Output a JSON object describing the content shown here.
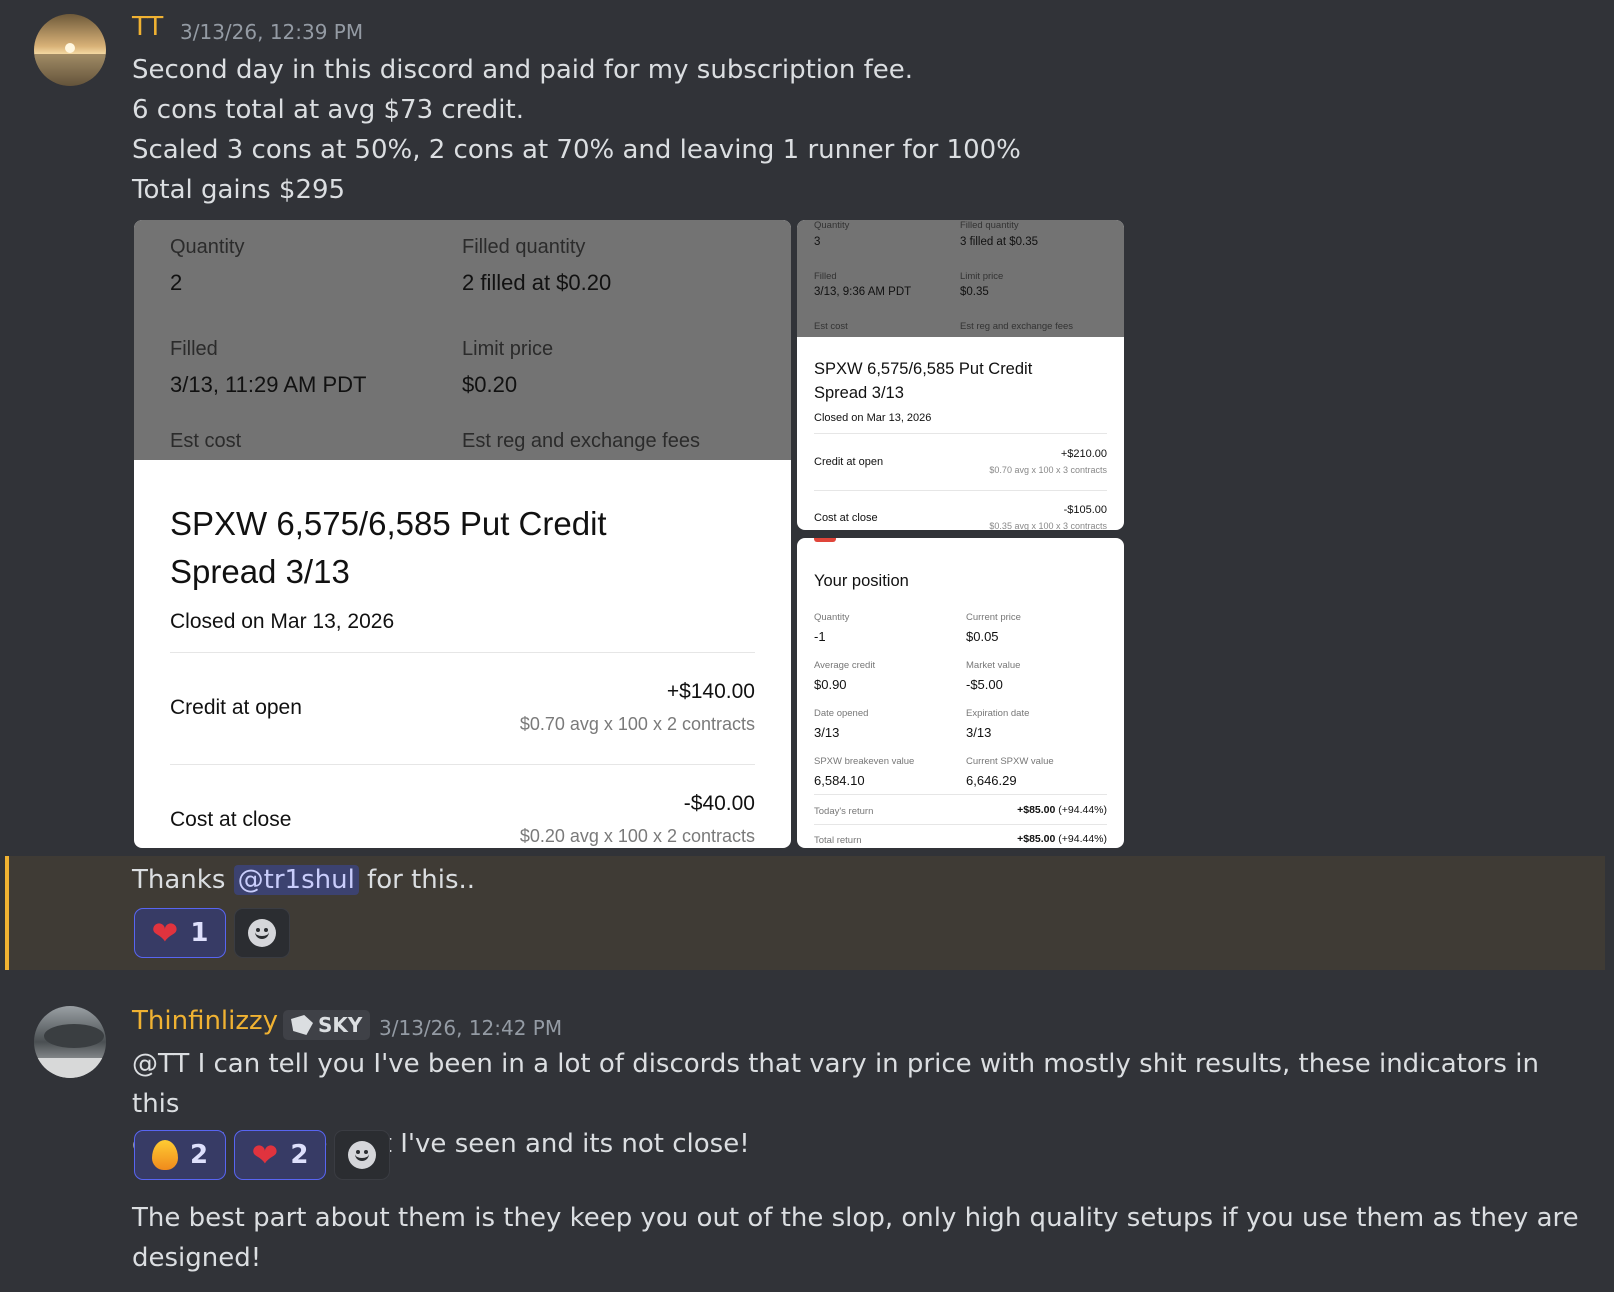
{
  "message1": {
    "author": "TT",
    "timestamp": "3/13/26, 12:39 PM",
    "lines": [
      "Second day in this discord and paid for my subscription fee.",
      "6 cons total at avg $73 credit.",
      "Scaled 3 cons at 50%, 2 cons at 70% and leaving 1 runner for 100%",
      "Total gains $295"
    ],
    "thanks_prefix": "Thanks ",
    "mention": "@tr1shul",
    "thanks_suffix": " for this..",
    "reactions": [
      {
        "emoji": "heart",
        "count": "1"
      }
    ]
  },
  "image_large": {
    "quantity_label": "Quantity",
    "quantity_value": "2",
    "filled_qty_label": "Filled quantity",
    "filled_qty_value": "2 filled at $0.20",
    "filled_label": "Filled",
    "filled_value": "3/13, 11:29 AM PDT",
    "limit_label": "Limit price",
    "limit_value": "$0.20",
    "est_cost_label": "Est cost",
    "est_fees_label": "Est reg and exchange fees",
    "title_line1": "SPXW 6,575/6,585 Put Credit",
    "title_line2": "Spread 3/13",
    "closed_on": "Closed on Mar 13, 2026",
    "credit_label": "Credit at open",
    "credit_value": "+$140.00",
    "credit_detail": "$0.70 avg x 100 x 2 contracts",
    "cost_label": "Cost at close",
    "cost_value": "-$40.00",
    "cost_detail": "$0.20 avg x 100 x 2 contracts"
  },
  "image_top_right": {
    "quantity_label": "Quantity",
    "quantity_value": "3",
    "filled_qty_label": "Filled quantity",
    "filled_qty_value": "3 filled at $0.35",
    "filled_label": "Filled",
    "filled_value": "3/13, 9:36 AM PDT",
    "limit_label": "Limit price",
    "limit_value": "$0.35",
    "est_cost_label": "Est cost",
    "est_fees_label": "Est reg and exchange fees",
    "title_line1": "SPXW 6,575/6,585 Put Credit",
    "title_line2": "Spread 3/13",
    "closed_on": "Closed on Mar 13, 2026",
    "credit_label": "Credit at open",
    "credit_value": "+$210.00",
    "credit_detail": "$0.70 avg x 100 x 3 contracts",
    "cost_label": "Cost at close",
    "cost_value": "-$105.00",
    "cost_detail": "$0.35 avg x 100 x 3 contracts"
  },
  "image_bottom_right": {
    "heading": "Your position",
    "quantity_label": "Quantity",
    "quantity_value": "-1",
    "current_price_label": "Current price",
    "current_price_value": "$0.05",
    "avg_credit_label": "Average credit",
    "avg_credit_value": "$0.90",
    "market_value_label": "Market value",
    "market_value_value": "-$5.00",
    "date_opened_label": "Date opened",
    "date_opened_value": "3/13",
    "expiration_label": "Expiration date",
    "expiration_value": "3/13",
    "breakeven_label": "SPXW breakeven value",
    "breakeven_value": "6,584.10",
    "current_spxw_label": "Current SPXW value",
    "current_spxw_value": "6,646.29",
    "todays_return_label": "Today's return",
    "todays_return_value": "+$85.00",
    "todays_return_pct": " (+94.44%)",
    "total_return_label": "Total return",
    "total_return_value": "+$85.00",
    "total_return_pct": " (+94.44%)"
  },
  "message2": {
    "author": "Thinfinlizzy",
    "tag": "SKY",
    "timestamp": "3/13/26, 12:42 PM",
    "line1": "@TT I can tell you I've been in a lot of discords that vary in price with mostly shit results, these indicators in this",
    "line2": "discord are the best I've seen and its not close!",
    "reactions": [
      {
        "emoji": "fire",
        "count": "2"
      },
      {
        "emoji": "heart",
        "count": "2"
      }
    ]
  },
  "message3": {
    "line1": "The best part about them is they keep you out of the slop, only high quality setups if you use them as they are",
    "line2": "designed!"
  },
  "colors": {
    "background": "#313338",
    "author": "#f0b232",
    "accent": "#5865f2",
    "highlight": "#3f3b35"
  }
}
